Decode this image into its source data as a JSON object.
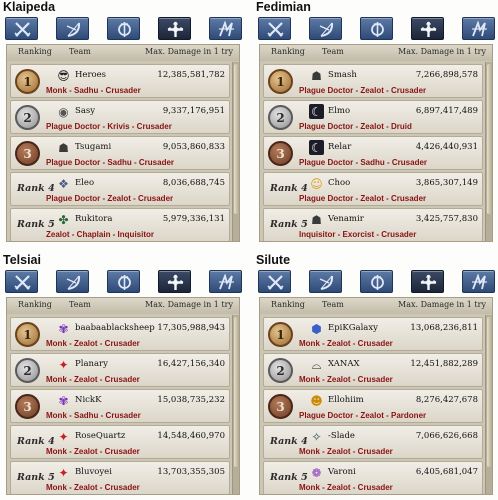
{
  "headers": {
    "ranking": "Ranking",
    "team": "Team",
    "damage": "Max. Damage in 1 try"
  },
  "colors": {
    "class_text": "#8a1212",
    "tab_blue": "#3f5f91",
    "tab_active": "#1d2638",
    "row_bg": "#e8e3d8"
  },
  "tabs": [
    {
      "icon": "crossed-swords-icon",
      "active": false
    },
    {
      "icon": "bow-icon",
      "active": false
    },
    {
      "icon": "wand-circle-icon",
      "active": false
    },
    {
      "icon": "cleric-cross-icon",
      "active": true
    },
    {
      "icon": "scout-blades-icon",
      "active": false
    }
  ],
  "panels": [
    {
      "region": "Klaipeda",
      "rows": [
        {
          "rank": "1",
          "player": "Heroes",
          "damage": "12,385,581,782",
          "classes": "Monk - Sadhu - Crusader",
          "avatar": "sunglasses-icon",
          "glyph": "😎"
        },
        {
          "rank": "2",
          "player": "Sasy",
          "damage": "9,337,176,951",
          "classes": "Plague Doctor - Krivis - Crusader",
          "avatar": "round-emblem-icon",
          "glyph": "◉"
        },
        {
          "rank": "3",
          "player": "Tsugami",
          "damage": "9,053,860,833",
          "classes": "Plague Doctor - Sadhu - Crusader",
          "avatar": "character-portrait-icon",
          "glyph": "☗"
        },
        {
          "rank": "Rank 4",
          "player": "Eleo",
          "damage": "8,036,688,745",
          "classes": "Plague Doctor - Zealot - Crusader",
          "avatar": "crest-icon",
          "glyph": "❖"
        },
        {
          "rank": "Rank 5",
          "player": "Rukitora",
          "damage": "5,979,336,131",
          "classes": "Zealot - Chaplain - Inquisitor",
          "avatar": "clover-emblem-icon",
          "glyph": "✤"
        }
      ]
    },
    {
      "region": "Fedimian",
      "rows": [
        {
          "rank": "1",
          "player": "Smash",
          "damage": "7,266,898,578",
          "classes": "Plague Doctor - Zealot - Crusader",
          "avatar": "character-portrait-icon",
          "glyph": "☗"
        },
        {
          "rank": "2",
          "player": "Elmo",
          "damage": "6,897,417,489",
          "classes": "Plague Doctor - Zealot - Druid",
          "avatar": "crescent-moon-icon",
          "glyph": "☾"
        },
        {
          "rank": "3",
          "player": "Relar",
          "damage": "4,426,440,931",
          "classes": "Plague Doctor - Sadhu - Crusader",
          "avatar": "crescent-moon-icon",
          "glyph": "☾"
        },
        {
          "rank": "Rank 4",
          "player": "Choo",
          "damage": "3,865,307,149",
          "classes": "Plague Doctor - Zealot - Crusader",
          "avatar": "smiley-icon",
          "glyph": "☺"
        },
        {
          "rank": "Rank 5",
          "player": "Venamir",
          "damage": "3,425,757,830",
          "classes": "Inquisitor - Exorcist - Crusader",
          "avatar": "character-portrait-icon",
          "glyph": "☗"
        }
      ]
    },
    {
      "region": "Telsiai",
      "rows": [
        {
          "rank": "1",
          "player": "baabaablacksheep",
          "damage": "17,305,988,943",
          "classes": "Monk - Zealot - Crusader",
          "avatar": "purple-creature-icon",
          "glyph": "✾"
        },
        {
          "rank": "2",
          "player": "Planary",
          "damage": "16,427,156,340",
          "classes": "Monk - Zealot - Crusader",
          "avatar": "red-bird-icon",
          "glyph": "✦"
        },
        {
          "rank": "3",
          "player": "NickK",
          "damage": "15,038,735,232",
          "classes": "Monk - Sadhu - Crusader",
          "avatar": "purple-creature-icon",
          "glyph": "✾"
        },
        {
          "rank": "Rank 4",
          "player": "RoseQuartz",
          "damage": "14,548,460,970",
          "classes": "Monk - Zealot - Crusader",
          "avatar": "red-bird-icon",
          "glyph": "✦"
        },
        {
          "rank": "Rank 5",
          "player": "Bluvoyei",
          "damage": "13,703,355,305",
          "classes": "Monk - Zealot - Crusader",
          "avatar": "red-bird-icon",
          "glyph": "✦"
        }
      ]
    },
    {
      "region": "Silute",
      "rows": [
        {
          "rank": "1",
          "player": "EpiKGalaxy",
          "damage": "13,068,236,811",
          "classes": "Monk - Zealot - Crusader",
          "avatar": "blue-shield-icon",
          "glyph": "⬢"
        },
        {
          "rank": "2",
          "player": "XANAX",
          "damage": "12,451,882,289",
          "classes": "Monk - Zealot - Crusader",
          "avatar": "hat-icon",
          "glyph": "⌓"
        },
        {
          "rank": "3",
          "player": "Ellohiim",
          "damage": "8,276,427,678",
          "classes": "Plague Doctor - Zealot - Pardoner",
          "avatar": "golden-skull-icon",
          "glyph": "☻"
        },
        {
          "rank": "Rank 4",
          "player": "-Slade",
          "damage": "7,066,626,668",
          "classes": "Monk - Zealot - Crusader",
          "avatar": "dark-bird-icon",
          "glyph": "✧"
        },
        {
          "rank": "Rank 5",
          "player": "Varoni",
          "damage": "6,405,681,047",
          "classes": "Monk - Zealot - Crusader",
          "avatar": "purple-gem-icon",
          "glyph": "❁"
        }
      ]
    }
  ]
}
